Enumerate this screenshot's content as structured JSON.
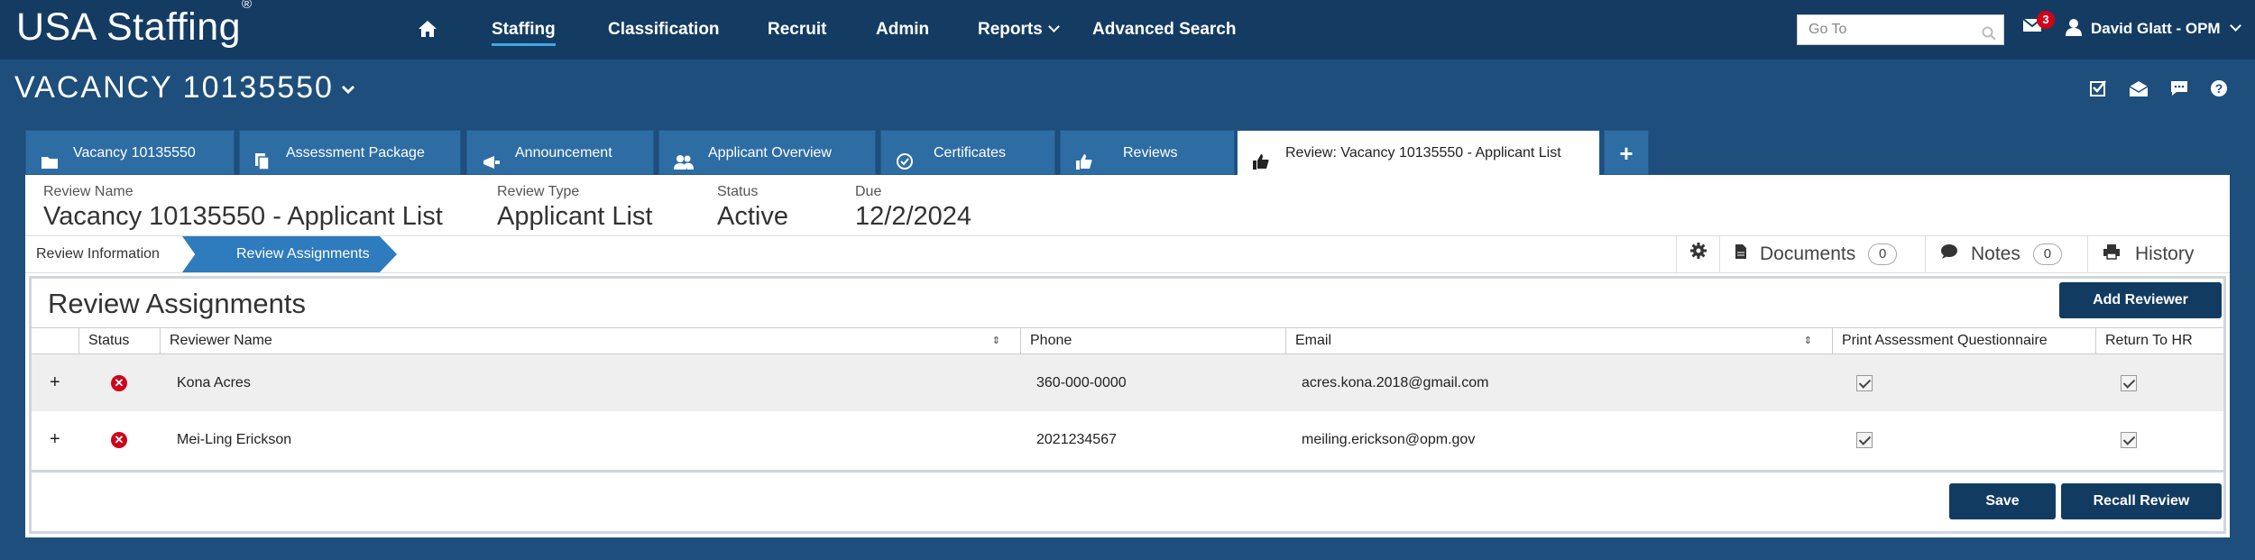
{
  "app": {
    "brand": "USA Staffing",
    "brand_mark": "®"
  },
  "nav": {
    "items": [
      "Staffing",
      "Classification",
      "Recruit",
      "Admin",
      "Reports",
      "Advanced Search"
    ],
    "active": "Staffing"
  },
  "header": {
    "goto_placeholder": "Go To",
    "mail_count": "3",
    "user_name": "David Glatt - OPM"
  },
  "vacancy": {
    "title": "VACANCY 10135550"
  },
  "tabs": [
    {
      "label": "Vacancy 10135550",
      "icon": "folder-icon"
    },
    {
      "label": "Assessment Package",
      "icon": "files-icon"
    },
    {
      "label": "Announcement",
      "icon": "megaphone-icon"
    },
    {
      "label": "Applicant Overview",
      "icon": "users-icon"
    },
    {
      "label": "Certificates",
      "icon": "check-circle-icon"
    },
    {
      "label": "Reviews",
      "icon": "thumbs-up-icon"
    },
    {
      "label": "Review: Vacancy 10135550 - Applicant List",
      "icon": "thumbs-up-icon"
    }
  ],
  "add_tab": "+",
  "review": {
    "name_label": "Review Name",
    "name_value": "Vacancy 10135550 - Applicant List",
    "type_label": "Review Type",
    "type_value": "Applicant List",
    "status_label": "Status",
    "status_value": "Active",
    "due_label": "Due",
    "due_value": "12/2/2024"
  },
  "steps": {
    "info": "Review Information",
    "assignments": "Review Assignments"
  },
  "tools": {
    "documents": "Documents",
    "documents_count": "0",
    "notes": "Notes",
    "notes_count": "0",
    "history": "History"
  },
  "assignments": {
    "title": "Review Assignments",
    "add_label": "Add Reviewer",
    "columns": [
      "Status",
      "Reviewer Name",
      "Phone",
      "Email",
      "Print Assessment Questionnaire",
      "Return To HR"
    ],
    "rows": [
      {
        "expand": "+",
        "name": "Kona Acres",
        "phone": "360-000-0000",
        "email": "acres.kona.2018@gmail.com"
      },
      {
        "expand": "+",
        "name": "Mei-Ling Erickson",
        "phone": "2021234567",
        "email": "meiling.erickson@opm.gov"
      }
    ],
    "save_label": "Save",
    "recall_label": "Recall Review"
  },
  "colors": {
    "navbar": "#143c63",
    "background": "#1d4e7c",
    "tab": "#2e6da4",
    "button": "#123b62",
    "error": "#d0021b"
  }
}
